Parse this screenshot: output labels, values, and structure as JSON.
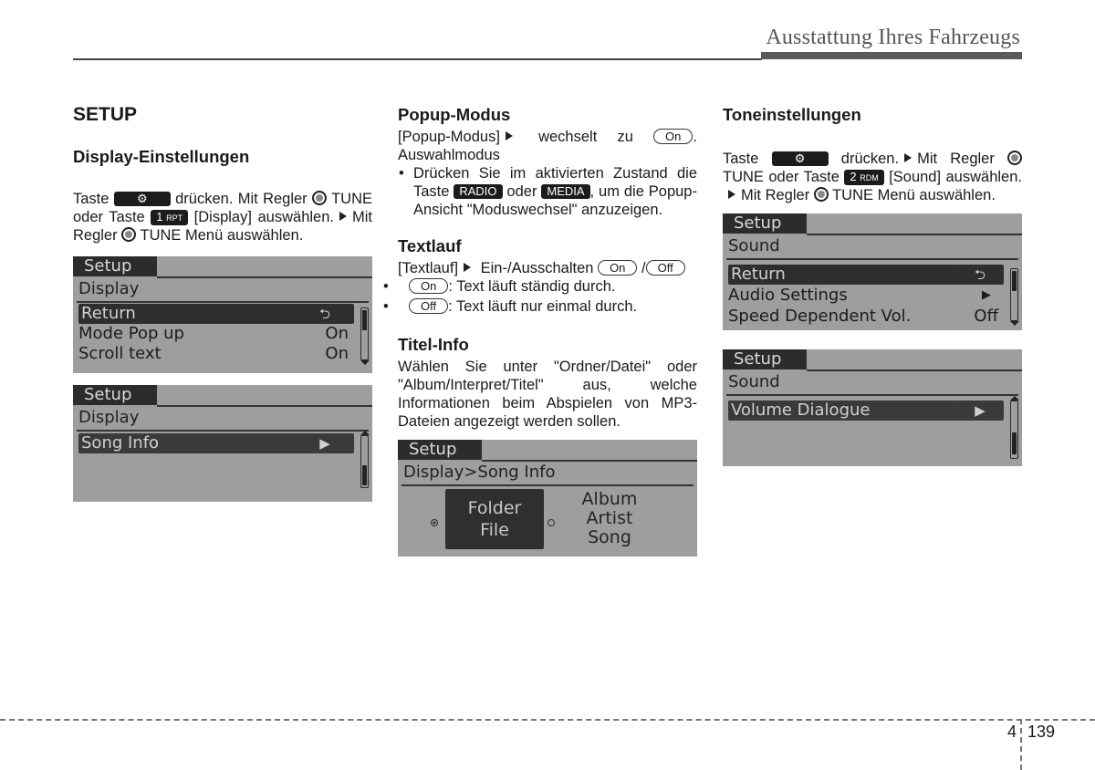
{
  "header": {
    "title": "Ausstattung Ihres Fahrzeugs"
  },
  "col1": {
    "section_title": "SETUP",
    "subtitle": "Display-Einstellungen",
    "p1_a": "Taste",
    "p1_b": "drücken. Mit Regler",
    "p1_c": "TUNE oder Taste",
    "p1_d": "[Display]",
    "p1_e": "auswählen.",
    "p1_f": "Mit Regler",
    "p1_g": "TUNE Menü auswählen.",
    "btn_1": "1",
    "btn_1_sub": "RPT",
    "screen1": {
      "tab": "Setup",
      "crumb": "Display",
      "rows": [
        {
          "label": "Return",
          "value": "return-arrow",
          "selected": true
        },
        {
          "label": "Mode Pop up",
          "value": "On"
        },
        {
          "label": "Scroll text",
          "value": "On"
        }
      ]
    },
    "screen2": {
      "tab": "Setup",
      "crumb": "Display",
      "rows": [
        {
          "label": "Song Info",
          "value": "▶",
          "selected": true
        }
      ]
    }
  },
  "col2": {
    "popup_title": "Popup-Modus",
    "popup_p1_a": "[Popup-Modus]",
    "popup_p1_b": "wechselt zu",
    "popup_on": "On",
    "popup_p1_c": ". Auswahlmodus",
    "popup_bullet_a": "Drücken Sie im aktivierten Zustand die Taste",
    "radio_btn": "RADIO",
    "popup_bullet_b": "oder",
    "media_btn": "MEDIA",
    "popup_bullet_c": ", um die Popup-Ansicht \"Moduswechsel\" anzuzeigen.",
    "textlauf_title": "Textlauf",
    "textlauf_p_a": "[Textlauf]",
    "textlauf_p_b": "Ein-/Ausschalten",
    "on": "On",
    "off": "Off",
    "textlauf_on_desc": ": Text läuft ständig durch.",
    "textlauf_off_desc": ": Text läuft nur einmal durch.",
    "titel_title": "Titel-Info",
    "titel_p": "Wählen Sie unter \"Ordner/Datei\" oder \"Album/Interpret/Titel\" aus, welche Informationen beim Abspielen von MP3-Dateien angezeigt werden sollen.",
    "screen3": {
      "tab": "Setup",
      "crumb": "Display>Song Info",
      "option1_line1": "Folder",
      "option1_line2": "File",
      "option2_line1": "Album",
      "option2_line2": "Artist",
      "option2_line3": "Song",
      "selected_option": "Folder/File"
    }
  },
  "col3": {
    "title": "Toneinstellungen",
    "p1_a": "Taste",
    "p1_b": "drücken.",
    "p1_c": "Mit Regler",
    "p1_d": "TUNE oder Taste",
    "btn_2": "2",
    "btn_2_sub": "RDM",
    "p1_e": "[Sound] auswählen.",
    "p1_f": "Mit Regler",
    "p1_g": "TUNE Menü auswählen.",
    "screen4": {
      "tab": "Setup",
      "crumb": "Sound",
      "rows": [
        {
          "label": "Return",
          "value": "return-arrow",
          "selected": true
        },
        {
          "label": "Audio Settings",
          "value": "▶"
        },
        {
          "label": "Speed Dependent Vol.",
          "value": "Off"
        }
      ]
    },
    "screen5": {
      "tab": "Setup",
      "crumb": "Sound",
      "rows": [
        {
          "label": "Volume Dialogue",
          "value": "▶",
          "selected": true
        }
      ]
    }
  },
  "footer": {
    "section": "4",
    "page": "139"
  }
}
